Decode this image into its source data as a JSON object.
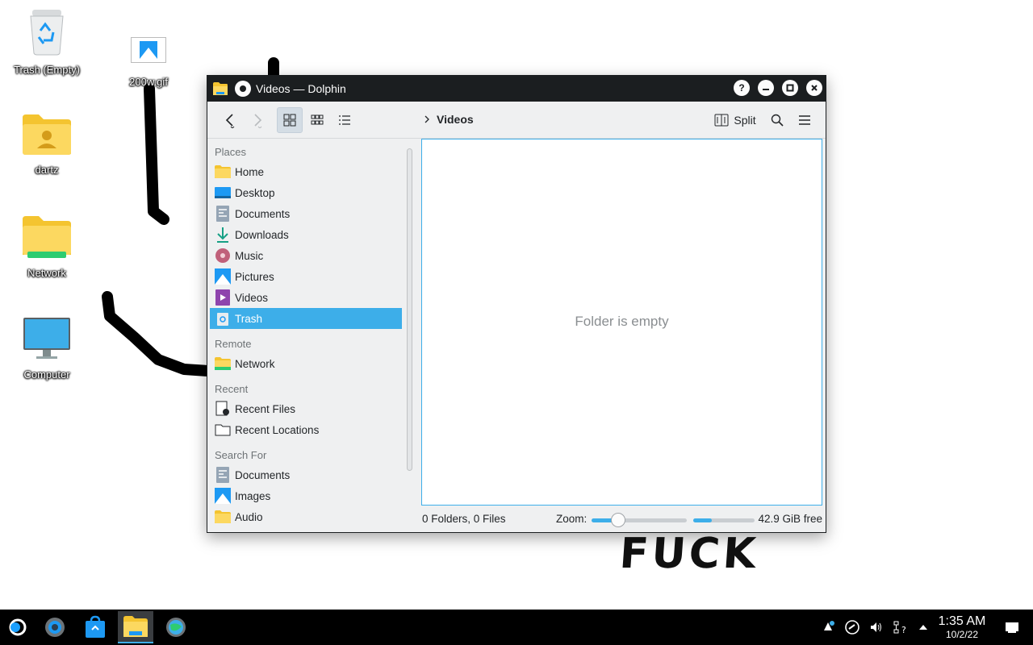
{
  "desktop": {
    "icons": [
      {
        "label": "Trash (Empty)"
      },
      {
        "label": "200w.gif"
      },
      {
        "label": "dartz"
      },
      {
        "label": "Network"
      },
      {
        "label": "Computer"
      }
    ],
    "graffiti_text": "FUCK"
  },
  "window": {
    "title": "Videos — Dolphin",
    "breadcrumb": "Videos",
    "split_label": "Split",
    "empty_message": "Folder is empty"
  },
  "sidebar": {
    "sections": [
      {
        "title": "Places",
        "items": [
          {
            "label": "Home",
            "icon": "folder-home-icon"
          },
          {
            "label": "Desktop",
            "icon": "desktop-icon"
          },
          {
            "label": "Documents",
            "icon": "documents-icon"
          },
          {
            "label": "Downloads",
            "icon": "downloads-icon"
          },
          {
            "label": "Music",
            "icon": "music-icon"
          },
          {
            "label": "Pictures",
            "icon": "pictures-icon"
          },
          {
            "label": "Videos",
            "icon": "videos-icon"
          },
          {
            "label": "Trash",
            "icon": "trash-icon",
            "selected": true
          }
        ]
      },
      {
        "title": "Remote",
        "items": [
          {
            "label": "Network",
            "icon": "network-folder-icon"
          }
        ]
      },
      {
        "title": "Recent",
        "items": [
          {
            "label": "Recent Files",
            "icon": "recent-files-icon"
          },
          {
            "label": "Recent Locations",
            "icon": "recent-locations-icon"
          }
        ]
      },
      {
        "title": "Search For",
        "items": [
          {
            "label": "Documents",
            "icon": "documents-icon"
          },
          {
            "label": "Images",
            "icon": "images-icon"
          },
          {
            "label": "Audio",
            "icon": "audio-folder-icon"
          }
        ]
      }
    ]
  },
  "status": {
    "counts": "0 Folders, 0 Files",
    "zoom_label": "Zoom:",
    "zoom_fraction": 0.28,
    "disk_used_fraction": 0.3,
    "free_space": "42.9 GiB free"
  },
  "taskbar": {
    "time": "1:35 AM",
    "date": "10/2/22"
  },
  "colors": {
    "accent": "#3daee9",
    "titlebar": "#1b1e20",
    "window_bg": "#eff0f1"
  }
}
